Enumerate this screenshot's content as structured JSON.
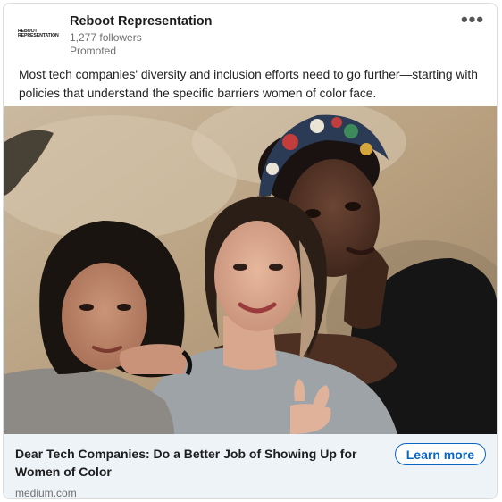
{
  "post": {
    "company": {
      "name": "Reboot Representation",
      "followers": "1,277 followers",
      "promoted": "Promoted",
      "logo_line1": "REBOOT",
      "logo_line2": "REPRESENTATION"
    },
    "more_icon": "ellipsis-horizontal-icon",
    "text": "Most tech companies' diversity and inclusion efforts need to go further—starting with policies that understand the specific barriers women of color face.",
    "image": {
      "subject": "photo-of-three-women"
    },
    "link": {
      "headline": "Dear Tech Companies: Do a Better Job of Showing Up for Women of Color",
      "domain": "medium.com",
      "cta_label": "Learn more"
    }
  },
  "colors": {
    "accent": "#0a66c2",
    "footer_background": "#eef3f8",
    "meta_text": "#707070"
  }
}
